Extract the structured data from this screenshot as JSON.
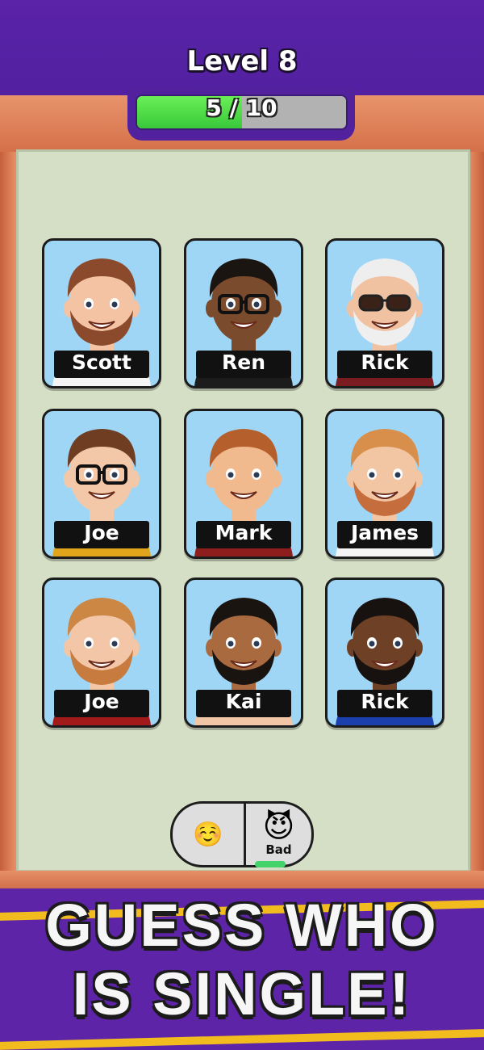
{
  "header": {
    "level_title": "Level 8"
  },
  "progress": {
    "text": "5 / 10",
    "current": 5,
    "total": 10,
    "fill_color": "#39c83a"
  },
  "cards": [
    {
      "name": "Scott",
      "skin": "#f3c3a4",
      "hair": "#8b4a2b",
      "beard": "#8b4a2b",
      "glasses": false,
      "sunglasses": false,
      "shirt": "#f5f5f5"
    },
    {
      "name": "Ren",
      "skin": "#7a4b2c",
      "hair": "#1b1512",
      "beard": "",
      "glasses": true,
      "sunglasses": false,
      "shirt": "#1c1c1c"
    },
    {
      "name": "Rick",
      "skin": "#f0c2a2",
      "hair": "#eeeeee",
      "beard": "#efefef",
      "glasses": false,
      "sunglasses": true,
      "shirt": "#7a1c20"
    },
    {
      "name": "Joe",
      "skin": "#f3c8a9",
      "hair": "#6e3d22",
      "beard": "",
      "glasses": true,
      "sunglasses": false,
      "shirt": "#e1a51b"
    },
    {
      "name": "Mark",
      "skin": "#f1b98e",
      "hair": "#b5602c",
      "beard": "",
      "glasses": false,
      "sunglasses": false,
      "shirt": "#8e1d1d"
    },
    {
      "name": "James",
      "skin": "#f2c5a3",
      "hair": "#d88f4b",
      "beard": "#c66d3d",
      "glasses": false,
      "sunglasses": false,
      "shirt": "#f5f5f5"
    },
    {
      "name": "Joe",
      "skin": "#f2c6a7",
      "hair": "#cc8745",
      "beard": "#c87b3e",
      "glasses": false,
      "sunglasses": false,
      "shirt": "#a31a1a"
    },
    {
      "name": "Kai",
      "skin": "#a96a40",
      "hair": "#1a1411",
      "beard": "#1a1411",
      "glasses": false,
      "sunglasses": false,
      "shirt": "#f0c6a6"
    },
    {
      "name": "Rick",
      "skin": "#6e4126",
      "hair": "#17120f",
      "beard": "#17120f",
      "glasses": false,
      "sunglasses": false,
      "shirt": "#1c3fae"
    }
  ],
  "emoji_toggle": {
    "left_icon": "☺️",
    "right_icon": "😈",
    "right_label": "Bad"
  },
  "banner": {
    "line1": "GUESS WHO",
    "line2": "IS SINGLE!"
  }
}
